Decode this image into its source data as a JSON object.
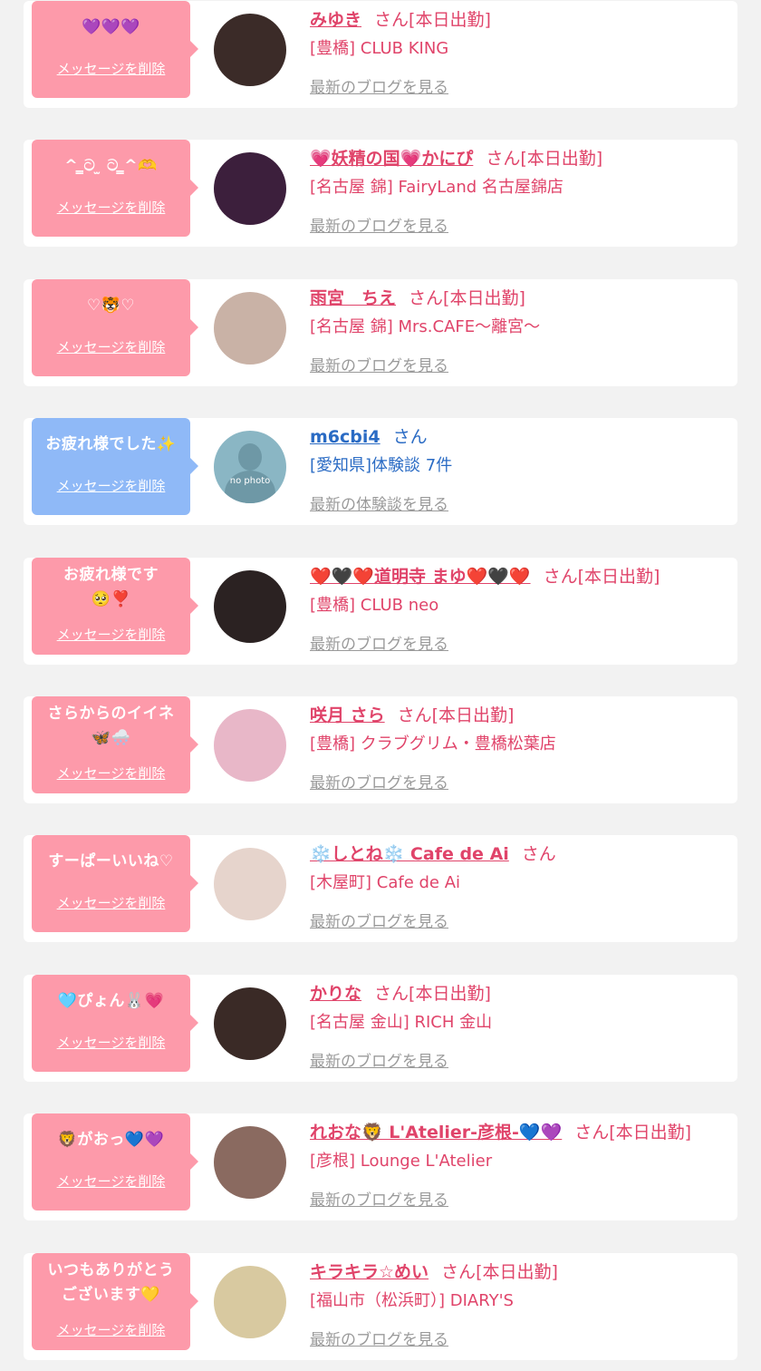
{
  "delete_label": "メッセージを削除",
  "san_label": "さん",
  "colors": {
    "pink_bubble": "#fd9aaa",
    "blue_bubble": "#8fb9f7",
    "pink_text": "#e0446a",
    "blue_text": "#2a6bc4",
    "link_gray": "#9a9a9a",
    "background": "#f2f2f2"
  },
  "messages": [
    {
      "bubble_text": "💜💜💜",
      "name": "みゆき",
      "status": "[本日出勤]",
      "shop": "[豊橋] CLUB KING",
      "link": "最新のブログを見る",
      "avatar_color": "#3b2b28",
      "theme": "pink"
    },
    {
      "bubble_text": "^ ̳ට ̫ ට ̳^🫶",
      "name": "💗妖精の国💗かにぴ",
      "status": "[本日出勤]",
      "shop": "[名古屋 錦] FairyLand 名古屋錦店",
      "link": "最新のブログを見る",
      "avatar_color": "#3c1f3c",
      "theme": "pink"
    },
    {
      "bubble_text": "♡🐯♡",
      "name": "雨宮　ちえ",
      "status": "[本日出勤]",
      "shop": "[名古屋 錦] Mrs.CAFE〜離宮〜",
      "link": "最新のブログを見る",
      "avatar_color": "#c9b2a6",
      "theme": "pink"
    },
    {
      "bubble_text": "お疲れ様でした✨",
      "name": "m6cbi4",
      "status": "",
      "shop": "[愛知県]体験談 7件",
      "link": "最新の体験談を見る",
      "avatar_color": "#8ab6c4",
      "avatar_note": "no photo",
      "theme": "blue"
    },
    {
      "bubble_text": "お疲れ様です\n🥺❣️",
      "name": "❤️🖤❤️道明寺 まゆ❤️🖤❤️",
      "status": "[本日出勤]",
      "shop": "[豊橋] CLUB neo",
      "link": "最新のブログを見る",
      "avatar_color": "#2b2222",
      "theme": "pink"
    },
    {
      "bubble_text": "さらからのイイネ\n🦋🌨️",
      "name": "咲月 さら",
      "status": "[本日出勤]",
      "shop": "[豊橋] クラブグリム・豊橋松葉店",
      "link": "最新のブログを見る",
      "avatar_color": "#e8b7c8",
      "theme": "pink"
    },
    {
      "bubble_text": "すーぱーいいね♡",
      "name": "❄️しとね❄️ Cafe de Ai",
      "status": "",
      "shop": "[木屋町] Cafe de Ai",
      "link": "最新のブログを見る",
      "avatar_color": "#e6d4cc",
      "theme": "pink"
    },
    {
      "bubble_text": "🩵ぴょん🐰💗",
      "name": "かりな",
      "status": "[本日出勤]",
      "shop": "[名古屋 金山] RICH 金山",
      "link": "最新のブログを見る",
      "avatar_color": "#3a2a26",
      "theme": "pink"
    },
    {
      "bubble_text": "🦁がおっ💙💜",
      "name": "れおな🦁 L'Atelier-彦根-💙💜",
      "status": "[本日出勤]",
      "shop": "[彦根] Lounge L'Atelier",
      "link": "最新のブログを見る",
      "avatar_color": "#8a6a60",
      "theme": "pink"
    },
    {
      "bubble_text": "いつもありがとう\nございます💛",
      "name": "キラキラ☆めい",
      "status": "[本日出勤]",
      "shop": "[福山市（松浜町）] DIARY'S",
      "link": "最新のブログを見る",
      "avatar_color": "#d8c9a0",
      "theme": "pink"
    }
  ]
}
